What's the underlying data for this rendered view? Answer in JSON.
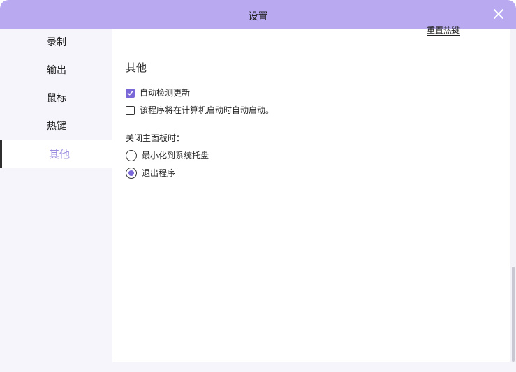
{
  "window": {
    "title": "设置"
  },
  "sidebar": {
    "items": [
      {
        "label": "录制"
      },
      {
        "label": "输出"
      },
      {
        "label": "鼠标"
      },
      {
        "label": "热键"
      },
      {
        "label": "其他",
        "active": true
      }
    ]
  },
  "content": {
    "reset_hotkey_label": "重置热键",
    "section_title": "其他",
    "checkboxes": [
      {
        "label": "自动检测更新",
        "checked": true
      },
      {
        "label": "该程序将在计算机启动时自动启动。",
        "checked": false
      }
    ],
    "close_panel_label": "关闭主面板时：",
    "radios": [
      {
        "label": "最小化到系统托盘",
        "checked": false
      },
      {
        "label": "退出程序",
        "checked": true
      }
    ]
  },
  "colors": {
    "titlebar": "#b8a9f1",
    "accent": "#7a68d8",
    "active_nav_text": "#9a8ce0",
    "sidebar_bg": "#f6f5fb"
  }
}
